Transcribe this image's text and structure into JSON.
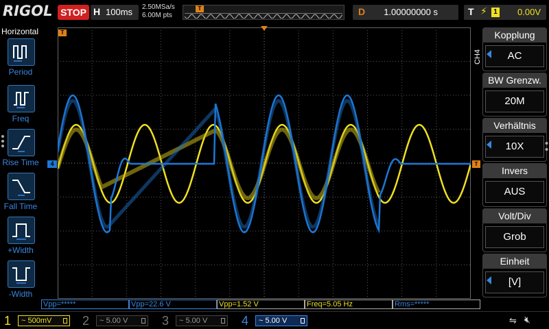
{
  "brand": "RIGOL",
  "run_state": "STOP",
  "timebase": {
    "label": "H",
    "value": "100ms"
  },
  "sample_rate": "2.50MSa/s",
  "mem_depth": "6.00M pts",
  "trigger_marker": "T",
  "delay": {
    "label": "D",
    "value": "1.00000000 s"
  },
  "trigger": {
    "label": "T",
    "icon": "rising-edge-icon",
    "channel": "1",
    "level": "0.00V"
  },
  "left_menu": {
    "title": "Horizontal",
    "items": [
      {
        "label": "Period",
        "icon": "period-icon"
      },
      {
        "label": "Freq",
        "icon": "freq-icon"
      },
      {
        "label": "Rise Time",
        "icon": "rise-time-icon"
      },
      {
        "label": "Fall Time",
        "icon": "fall-time-icon"
      },
      {
        "label": "+Width",
        "icon": "positive-width-icon"
      },
      {
        "label": "-Width",
        "icon": "negative-width-icon"
      }
    ]
  },
  "right_menu": {
    "channel_tag": "CH4",
    "items": [
      {
        "title": "Kopplung",
        "value": "AC",
        "arrow": true
      },
      {
        "title": "BW Grenzw.",
        "value": "20M",
        "arrow": false
      },
      {
        "title": "Verhältnis",
        "value": "10X",
        "arrow": true
      },
      {
        "title": "Invers",
        "value": "AUS",
        "arrow": false
      },
      {
        "title": "Volt/Div",
        "value": "Grob",
        "arrow": false
      },
      {
        "title": "Einheit",
        "value": "[V]",
        "arrow": true
      }
    ]
  },
  "measurements": [
    {
      "text": "Vpp=*****",
      "color": "#3a86e0"
    },
    {
      "text": "Vpp=22.6 V",
      "color": "#3a86e0"
    },
    {
      "text": "Vpp=1.52 V",
      "color": "#f0e020"
    },
    {
      "text": "Freq=5.05 Hz",
      "color": "#f0e020"
    },
    {
      "text": "Rms=*****",
      "color": "#3a86e0"
    }
  ],
  "channels": [
    {
      "num": "1",
      "scale": "~ 500mV",
      "color": "#f0e020",
      "active": true
    },
    {
      "num": "2",
      "scale": "~ 5.00 V",
      "color": "#777777",
      "active": false
    },
    {
      "num": "3",
      "scale": "~ 5.00 V",
      "color": "#777777",
      "active": false
    },
    {
      "num": "4",
      "scale": "~ 5.00 V",
      "color": "#3a86e0",
      "active": true
    }
  ],
  "markers": {
    "ch4_level": "4",
    "trigger_level": "T"
  },
  "colors": {
    "ch1": "#f0e020",
    "ch4": "#1c78d8",
    "accent_orange": "#e08018",
    "stop_red": "#d02020",
    "grid": "#5a5a5a"
  }
}
